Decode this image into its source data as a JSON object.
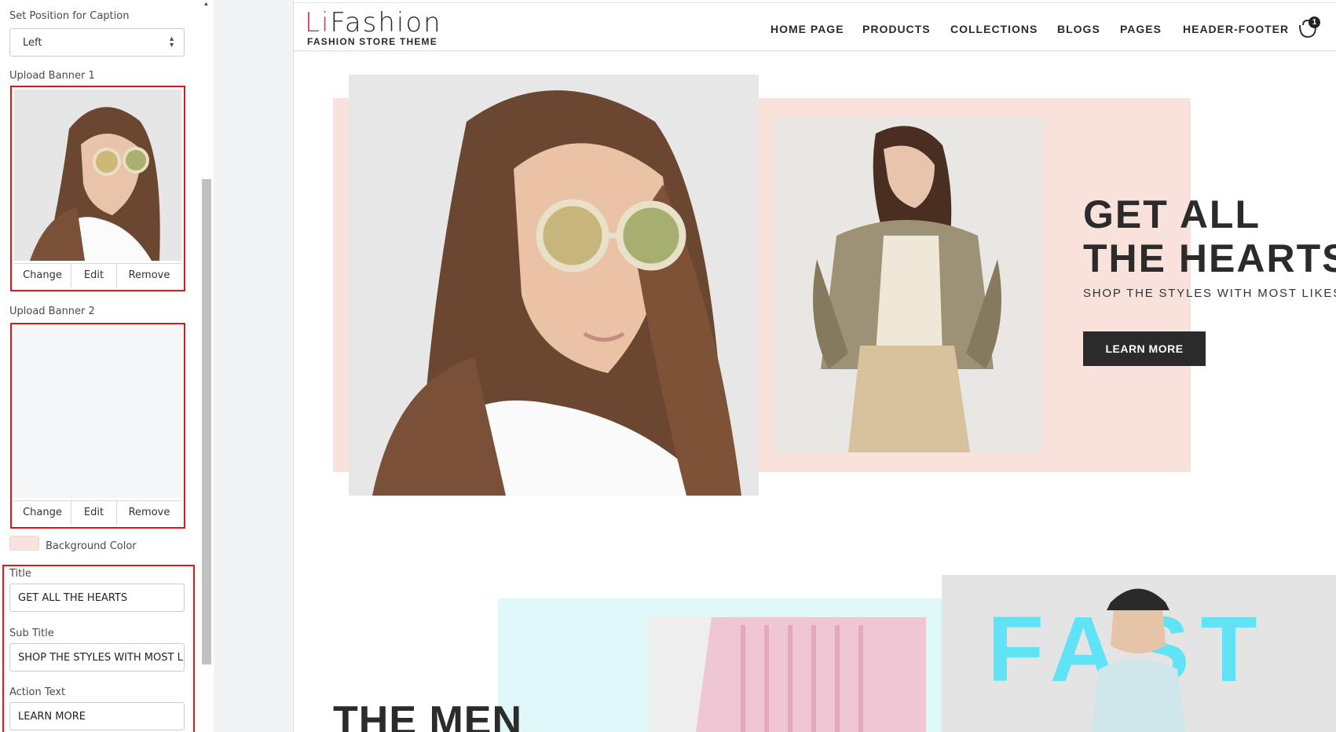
{
  "panel": {
    "caption_position_label": "Set Position for Caption",
    "caption_position_value": "Left",
    "banner1_label": "Upload Banner 1",
    "banner2_label": "Upload Banner 2",
    "actions": {
      "change": "Change",
      "edit": "Edit",
      "remove": "Remove"
    },
    "background_color_label": "Background Color",
    "background_color": "#f9e2dc",
    "title_label": "Title",
    "title_value": "GET ALL THE HEARTS",
    "subtitle_label": "Sub Title",
    "subtitle_value": "SHOP THE STYLES WITH MOST LIKES",
    "action_text_label": "Action Text",
    "action_text_value": "LEARN MORE"
  },
  "store": {
    "logo_accent": "Li",
    "logo_rest": "Fashion",
    "tagline": "FASHION STORE THEME",
    "nav": [
      "HOME PAGE",
      "PRODUCTS",
      "COLLECTIONS",
      "BLOGS",
      "PAGES",
      "HEADER-FOOTER"
    ],
    "cart_icon": "cart-icon",
    "cart_count": "1",
    "accent_color": "#e0245e"
  },
  "hero": {
    "title": "GET ALL THE HEARTS",
    "subtitle": "SHOP THE STYLES WITH MOST LIKES",
    "button": "LEARN MORE"
  },
  "second_section": {
    "title": "THE MEN",
    "graphic_text": "FAST"
  }
}
